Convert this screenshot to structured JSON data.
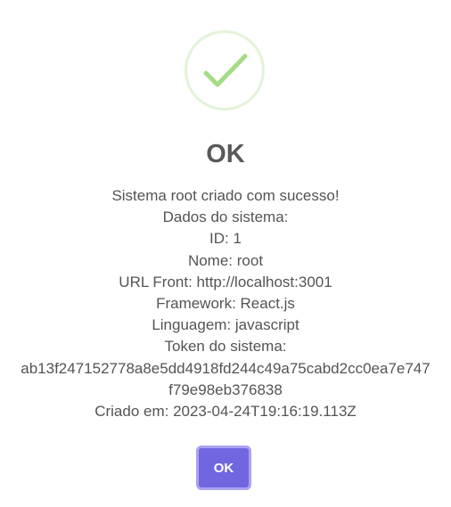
{
  "dialog": {
    "icon": "success-checkmark-icon",
    "title": "OK",
    "lines": [
      "Sistema root criado com sucesso!",
      "Dados do sistema:",
      "ID: 1",
      "Nome: root",
      "URL Front: http://localhost:3001",
      "Framework: React.js",
      "Linguagem: javascript",
      "Token do sistema:"
    ],
    "token": "ab13f247152778a8e5dd4918fd244c49a75cabd2cc0ea7e747f79e98eb376838",
    "created_at": "Criado em: 2023-04-24T19:16:19.113Z",
    "confirm_label": "OK"
  },
  "colors": {
    "accent": "#7066e0",
    "success": "#a5dc86",
    "text": "#545454"
  }
}
